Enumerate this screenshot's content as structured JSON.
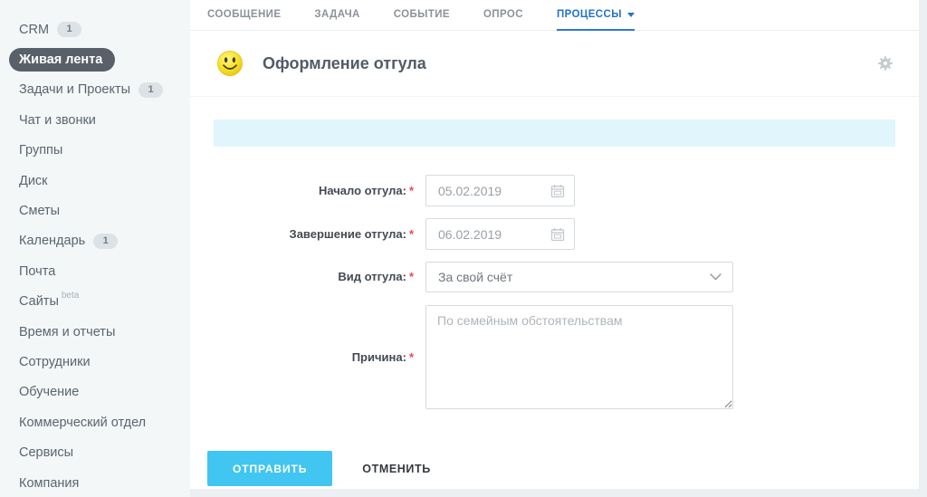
{
  "sidebar": {
    "items": [
      {
        "label": "CRM",
        "badge": "1"
      },
      {
        "label": "Живая лента",
        "active": true
      },
      {
        "label": "Задачи и Проекты",
        "badge": "1"
      },
      {
        "label": "Чат и звонки"
      },
      {
        "label": "Группы"
      },
      {
        "label": "Диск"
      },
      {
        "label": "Сметы"
      },
      {
        "label": "Календарь",
        "badge": "1"
      },
      {
        "label": "Почта"
      },
      {
        "label": "Сайты",
        "suffix": "beta"
      },
      {
        "label": "Время и отчеты"
      },
      {
        "label": "Сотрудники"
      },
      {
        "label": "Обучение"
      },
      {
        "label": "Коммерческий отдел"
      },
      {
        "label": "Сервисы"
      },
      {
        "label": "Компания"
      }
    ]
  },
  "tabs": [
    {
      "label": "СООБЩЕНИЕ"
    },
    {
      "label": "ЗАДАЧА"
    },
    {
      "label": "СОБЫТИЕ"
    },
    {
      "label": "ОПРОС"
    },
    {
      "label": "ПРОЦЕССЫ",
      "active": true,
      "has_caret": true
    }
  ],
  "header": {
    "title": "Оформление отгула",
    "icon": "smiley-icon",
    "action_icon": "gear-icon"
  },
  "form": {
    "required_marker": "*",
    "fields": [
      {
        "type": "date",
        "label": "Начало отгула:",
        "value": "05.02.2019"
      },
      {
        "type": "date",
        "label": "Завершение отгула:",
        "value": "06.02.2019"
      },
      {
        "type": "select",
        "label": "Вид отгула:",
        "value": "За свой счёт"
      },
      {
        "type": "textarea",
        "label": "Причина:",
        "placeholder": "По семейным обстоятельствам"
      }
    ],
    "buttons": {
      "submit": "ОТПРАВИТЬ",
      "cancel": "ОТМЕНИТЬ"
    }
  },
  "colors": {
    "page_background": "#ecf0f2",
    "sidebar_background": "#f4f7f8",
    "active_pill": "#596069",
    "active_tab_blue": "#2273c9",
    "notice_bar_blue": "#e1f5fd",
    "submit_button_blue": "#41c5f1",
    "required_red": "#ef4646"
  }
}
